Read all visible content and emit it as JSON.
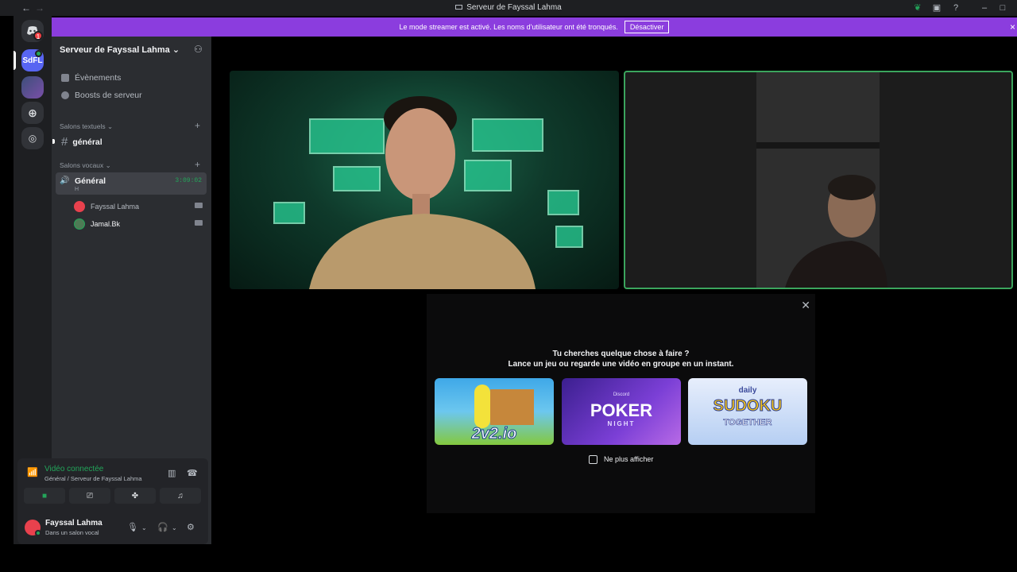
{
  "window": {
    "title": "Serveur de Fayssal Lahma",
    "back_glyph": "←",
    "forward_glyph": "→",
    "minimize_glyph": "–",
    "maximize_glyph": "□"
  },
  "banner": {
    "message": "Le mode streamer est activé. Les noms d'utilisateur ont été tronqués.",
    "button_label": "Désactiver",
    "bg_color": "#8b3dde"
  },
  "rail": {
    "dm_badge": "1",
    "server_label": "SdFL"
  },
  "server": {
    "name": "Serveur de Fayssal Lahma ⌄",
    "links": [
      "Évènements",
      "Boosts de serveur"
    ],
    "text_category": "Salons textuels ⌄",
    "text_channels": [
      "général"
    ],
    "voice_category": "Salons vocaux ⌄",
    "voice_channel": {
      "name": "Général",
      "timer": "3:09:02",
      "sub": "H",
      "users": [
        "Fayssal Lahma",
        "Jamal.Bk"
      ]
    }
  },
  "voice_panel": {
    "status": "Vidéo connectée",
    "location": "Général / Serveur de Fayssal Lahma"
  },
  "user_panel": {
    "name": "Fayssal Lahma",
    "status": "Dans un salon vocal"
  },
  "activity": {
    "line1": "Tu cherches quelque chose à faire ?",
    "line2": "Lance un jeu ou regarde une vidéo en groupe en un instant.",
    "games": [
      {
        "title": "2v2.io"
      },
      {
        "title": "POKER",
        "subtitle": "NIGHT",
        "brand": "Discord"
      },
      {
        "title": "SUDOKU",
        "top": "daily",
        "bottom": "TOGETHER"
      }
    ],
    "checkbox_label": "Ne plus afficher"
  },
  "colors": {
    "accent_green": "#23a55a",
    "speaking_border": "#3ba55d"
  }
}
